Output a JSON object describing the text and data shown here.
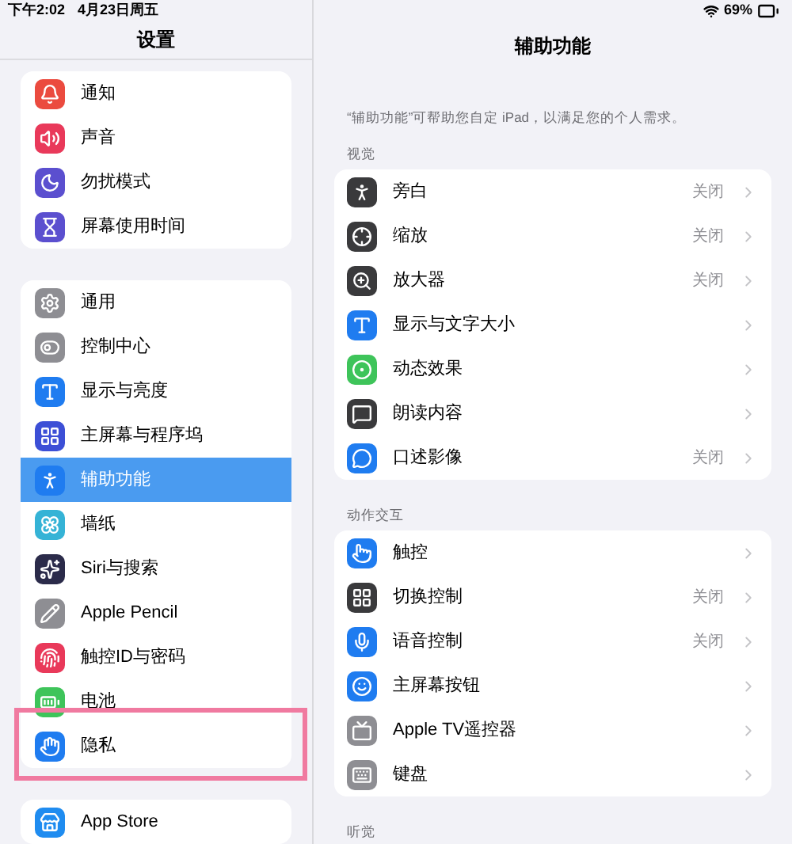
{
  "status_bar": {
    "time": "下午2:02",
    "date": "4月23日周五",
    "battery": "69%"
  },
  "sidebar": {
    "title": "设置",
    "groups": [
      [
        {
          "label": "通知",
          "color": "#eb4b3f",
          "selected": false,
          "highlighted": false
        },
        {
          "label": "声音",
          "color": "#e9395a",
          "selected": false,
          "highlighted": false
        },
        {
          "label": "勿扰模式",
          "color": "#5b4fcf",
          "selected": false,
          "highlighted": false
        },
        {
          "label": "屏幕使用时间",
          "color": "#5b4fcf",
          "selected": false,
          "highlighted": false
        }
      ],
      [
        {
          "label": "通用",
          "color": "#8e8e93",
          "selected": false,
          "highlighted": false
        },
        {
          "label": "控制中心",
          "color": "#8e8e93",
          "selected": false,
          "highlighted": false
        },
        {
          "label": "显示与亮度",
          "color": "#1f7cf0",
          "selected": false,
          "highlighted": false
        },
        {
          "label": "主屏幕与程序坞",
          "color": "#3c4fd6",
          "selected": false,
          "highlighted": false
        },
        {
          "label": "辅助功能",
          "color": "#1f7cf0",
          "selected": true,
          "highlighted": false
        },
        {
          "label": "墙纸",
          "color": "#35b3d6",
          "selected": false,
          "highlighted": false
        },
        {
          "label": "Siri与搜索",
          "color": "#2b2b4a",
          "selected": false,
          "highlighted": false
        },
        {
          "label": "Apple Pencil",
          "color": "#8e8e93",
          "selected": false,
          "highlighted": false
        },
        {
          "label": "触控ID与密码",
          "color": "#e9395a",
          "selected": false,
          "highlighted": false
        },
        {
          "label": "电池",
          "color": "#3ec45a",
          "selected": false,
          "highlighted": false
        },
        {
          "label": "隐私",
          "color": "#1f7cf0",
          "selected": false,
          "highlighted": true
        }
      ],
      [
        {
          "label": "App Store",
          "color": "#1f8cf0",
          "selected": false,
          "highlighted": false
        }
      ]
    ]
  },
  "detail": {
    "title": "辅助功能",
    "description": "“辅助功能”可帮助您自定 iPad，以满足您的个人需求。",
    "sections": [
      {
        "label": "视觉",
        "rows": [
          {
            "label": "旁白",
            "value": "关闭",
            "color": "#3a3a3c"
          },
          {
            "label": "缩放",
            "value": "关闭",
            "color": "#3a3a3c"
          },
          {
            "label": "放大器",
            "value": "关闭",
            "color": "#3a3a3c"
          },
          {
            "label": "显示与文字大小",
            "color": "#1f7cf0"
          },
          {
            "label": "动态效果",
            "color": "#3ec45a"
          },
          {
            "label": "朗读内容",
            "color": "#3a3a3c"
          },
          {
            "label": "口述影像",
            "value": "关闭",
            "color": "#1f7cf0"
          }
        ]
      },
      {
        "label": "动作交互",
        "rows": [
          {
            "label": "触控",
            "color": "#1f7cf0"
          },
          {
            "label": "切换控制",
            "value": "关闭",
            "color": "#3a3a3c"
          },
          {
            "label": "语音控制",
            "value": "关闭",
            "color": "#1f7cf0"
          },
          {
            "label": "主屏幕按钮",
            "color": "#1f7cf0"
          },
          {
            "label": "Apple TV遥控器",
            "color": "#8e8e93"
          },
          {
            "label": "键盘",
            "color": "#8e8e93"
          }
        ]
      },
      {
        "label": "听觉"
      }
    ]
  }
}
